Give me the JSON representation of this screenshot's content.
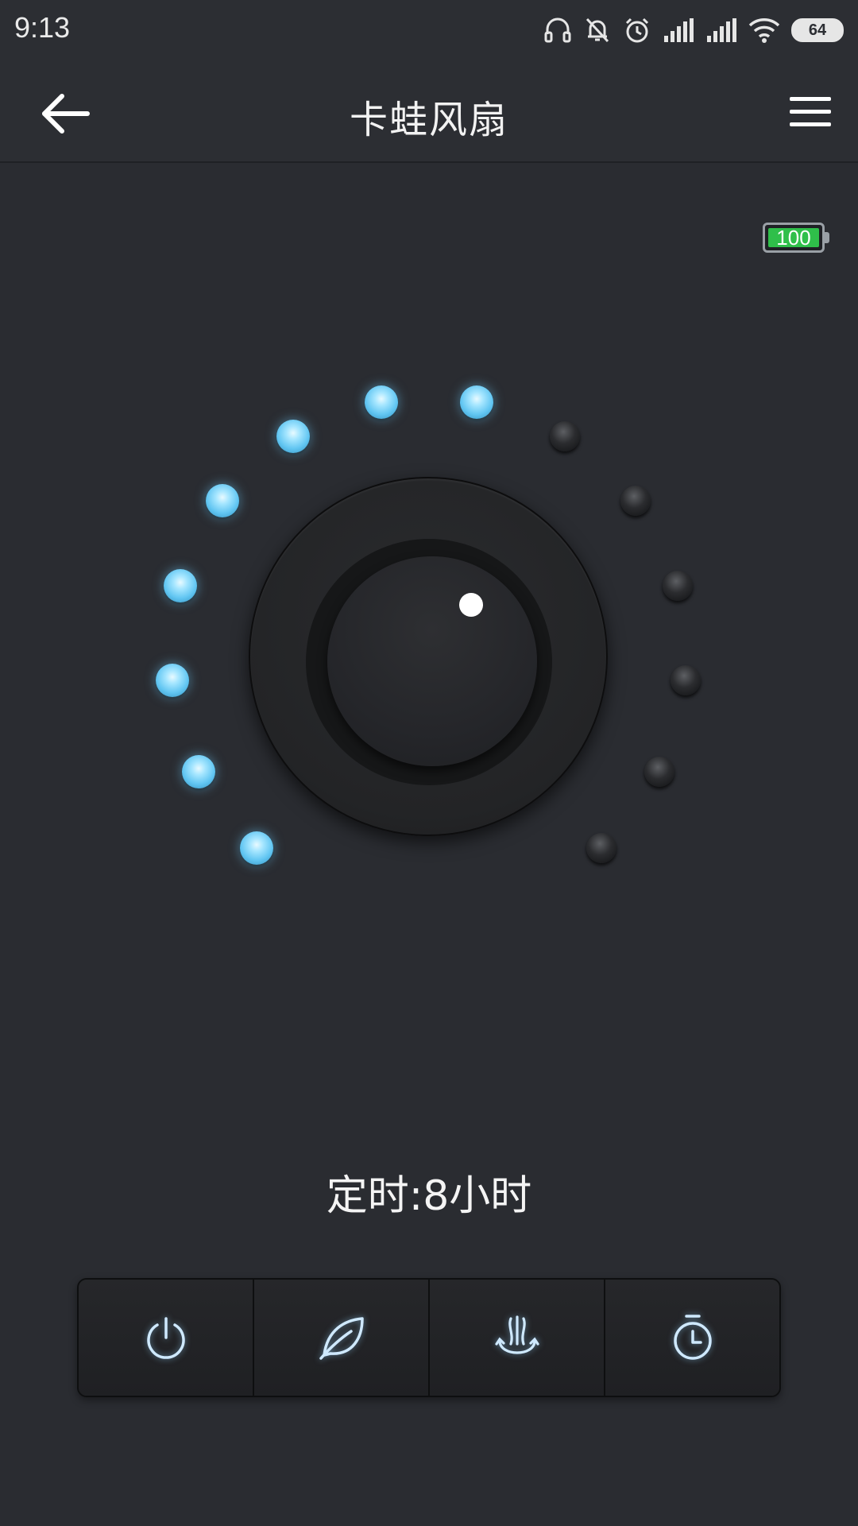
{
  "status_bar": {
    "time": "9:13",
    "battery_level": "64",
    "icons": [
      "headset-icon",
      "bell-off-icon",
      "alarm-icon",
      "signal-icon",
      "signal-icon",
      "wifi-icon",
      "battery-icon"
    ]
  },
  "app_bar": {
    "title": "卡蛙风扇",
    "back_icon": "arrow-left-icon",
    "menu_icon": "menu-icon"
  },
  "device": {
    "battery_percent": "100",
    "speed_level": 8,
    "speed_levels_total": 14
  },
  "timer": {
    "label": "定时:8小时"
  },
  "controls": [
    {
      "name": "power",
      "icon": "power-icon"
    },
    {
      "name": "natural-wind",
      "icon": "leaf-icon"
    },
    {
      "name": "swing",
      "icon": "swing-icon"
    },
    {
      "name": "timer",
      "icon": "timer-icon"
    }
  ],
  "colors": {
    "background": "#2a2c31",
    "led_on": "#62c6f2",
    "battery_fill": "#2fbf4a"
  }
}
